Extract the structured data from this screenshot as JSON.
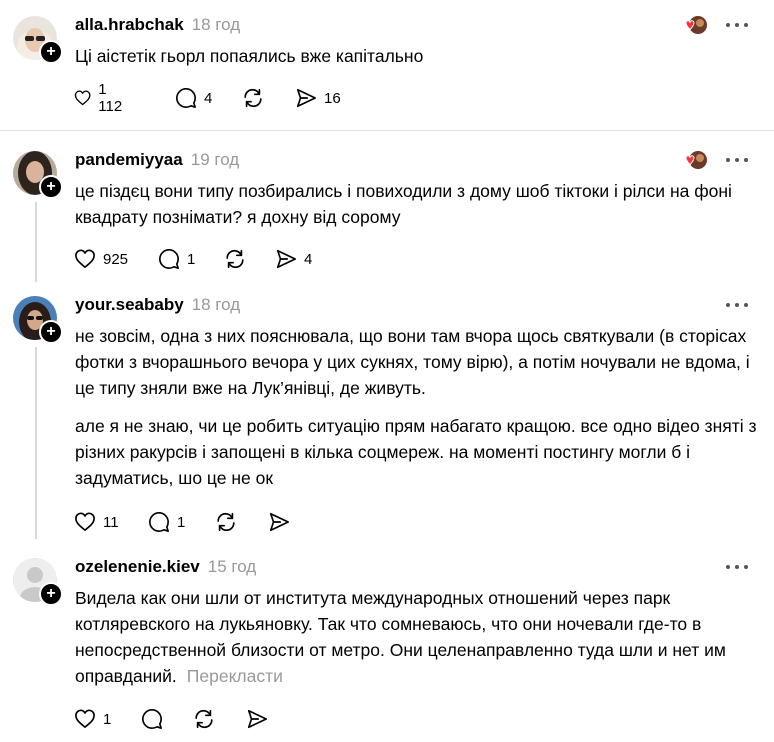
{
  "posts": [
    {
      "username": "alla.hrabchak",
      "time": "18 год",
      "paragraphs": [
        "Ці аістетік гьорл попаялись вже капітально"
      ],
      "likes": "1 112",
      "replies": "4",
      "reposts": "",
      "shares": "16"
    },
    {
      "username": "pandemiyyaa",
      "time": "19 год",
      "paragraphs": [
        "це піздєц вони типу позбирались і повиходили з дому шоб тіктоки і рілси на фоні квадрату познімати? я дохну від сорому"
      ],
      "likes": "925",
      "replies": "1",
      "reposts": "",
      "shares": "4"
    },
    {
      "username": "your.seababy",
      "time": "18 год",
      "paragraphs": [
        "не зовсім, одна з них пояснювала, що вони там вчора щось святкували (в сторісах фотки з вчорашнього вечора у цих сукнях, тому вірю), а потім ночували не вдома, і це типу зняли вже на Лук’янівці, де живуть.",
        "але я не знаю, чи це робить ситуацію прям набагато кращою. все одно відео зняті з різних ракурсів і запощені в кілька соцмереж. на моменті постингу могли б і задуматись, шо це не ок"
      ],
      "likes": "11",
      "replies": "1",
      "reposts": "",
      "shares": ""
    },
    {
      "username": "ozelenenie.kiev",
      "time": "15 год",
      "paragraphs": [
        "Видела как они шли от института международных отношений через парк котляревского на лукьяновку. Так что сомневаюсь, что они ночевали где-то в непосредственной близости от метро. Они целенаправленно туда шли и нет им оправданий."
      ],
      "translate": "Перекласти",
      "likes": "1",
      "replies": "",
      "reposts": "",
      "shares": ""
    }
  ],
  "colors": {
    "text": "#000000",
    "muted": "#999999",
    "divider": "#e2e2e2",
    "heart": "#ff3040"
  }
}
